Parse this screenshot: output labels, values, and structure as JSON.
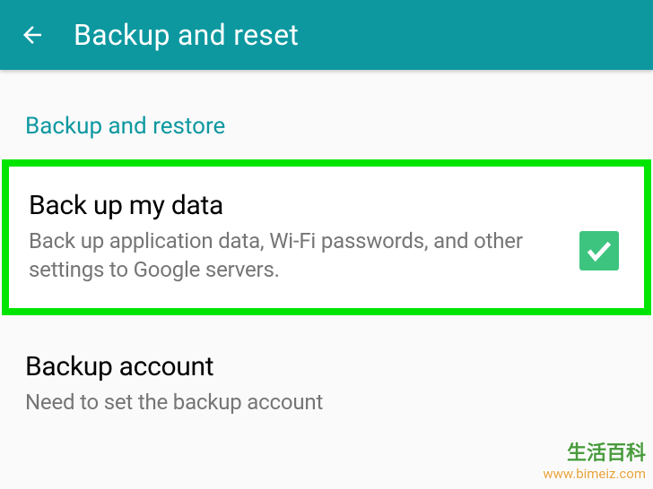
{
  "appBar": {
    "title": "Backup and reset"
  },
  "section": {
    "header": "Backup and restore"
  },
  "items": {
    "backupData": {
      "title": "Back up my data",
      "subtitle": "Back up application data, Wi-Fi passwords, and other settings to Google servers.",
      "checked": true
    },
    "backupAccount": {
      "title": "Backup account",
      "subtitle": "Need to set the backup account"
    }
  },
  "watermark": {
    "cn": "生活百科",
    "url": "www.bimeiz.com"
  },
  "colors": {
    "primary": "#0d98a0",
    "highlight": "#00e500",
    "checkbox": "#3dc47e"
  }
}
